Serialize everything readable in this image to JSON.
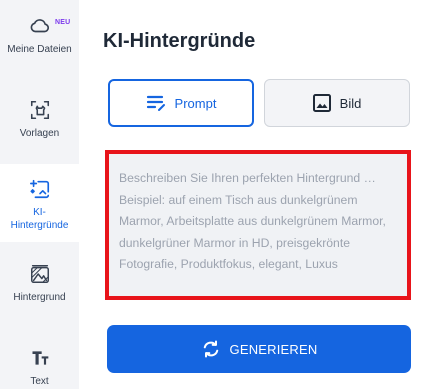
{
  "sidebar": {
    "items": [
      {
        "label": "Meine Dateien",
        "icon": "cloud-icon",
        "badge": "NEU",
        "active": false
      },
      {
        "label": "Vorlagen",
        "icon": "template-icon",
        "active": false
      },
      {
        "label": "KI-\nHintergründe",
        "icon": "ai-background-icon",
        "active": true
      },
      {
        "label": "Hintergrund",
        "icon": "background-icon",
        "active": false
      },
      {
        "label": "Text",
        "icon": "text-icon",
        "active": false
      }
    ]
  },
  "main": {
    "title": "KI-Hintergründe",
    "modes": {
      "prompt_label": "Prompt",
      "image_label": "Bild"
    },
    "prompt": {
      "value": "",
      "placeholder": "Beschreiben Sie Ihren perfekten Hintergrund … Beispiel: auf einem Tisch aus dunkelgrünem Marmor, Arbeitsplatte aus dunkelgrünem Marmor, dunkelgrüner Marmor in HD, preisgekrönte Fotografie, Produktfokus, elegant, Luxus"
    },
    "generate_label": "GENERIEREN"
  },
  "colors": {
    "accent": "#1565e0",
    "highlight_border": "#e8141a",
    "badge": "#7c3aed",
    "sidebar_bg": "#f3f4f7"
  }
}
